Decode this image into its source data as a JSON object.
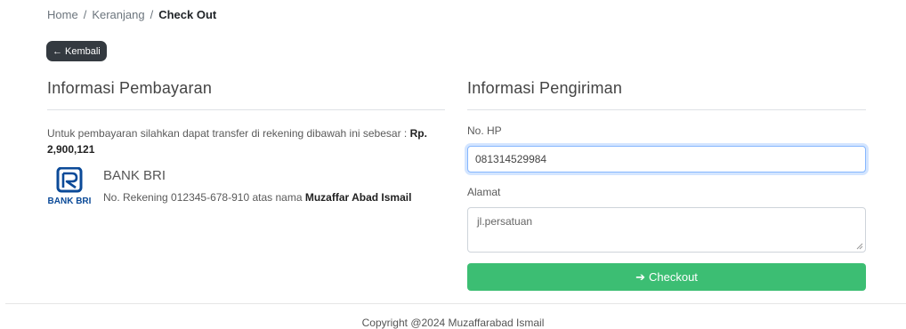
{
  "breadcrumb": {
    "home": "Home",
    "cart": "Keranjang",
    "current": "Check Out",
    "separator": "/"
  },
  "back_button": {
    "label": "Kembali",
    "icon": "arrow-left-icon"
  },
  "payment": {
    "title": "Informasi Pembayaran",
    "instruction": "Untuk pembayaran silahkan dapat transfer di rekening dibawah ini sebesar :",
    "amount": "Rp. 2,900,121",
    "bank_logo_text": "BANK BRI",
    "bank_name": "BANK BRI",
    "account_prefix": "No. Rekening 012345-678-910 atas nama",
    "account_holder": "Muzaffar Abad Ismail",
    "bank_color": "#0b4a98"
  },
  "shipping": {
    "title": "Informasi Pengiriman",
    "phone_label": "No. HP",
    "phone_value": "081314529984",
    "address_label": "Alamat",
    "address_value": "jl.persatuan"
  },
  "checkout_button": {
    "label": "Checkout",
    "icon": "arrow-right-icon",
    "color": "#3cbe73"
  },
  "footer": {
    "text": "Copyright @2024 Muzaffarabad Ismail"
  }
}
